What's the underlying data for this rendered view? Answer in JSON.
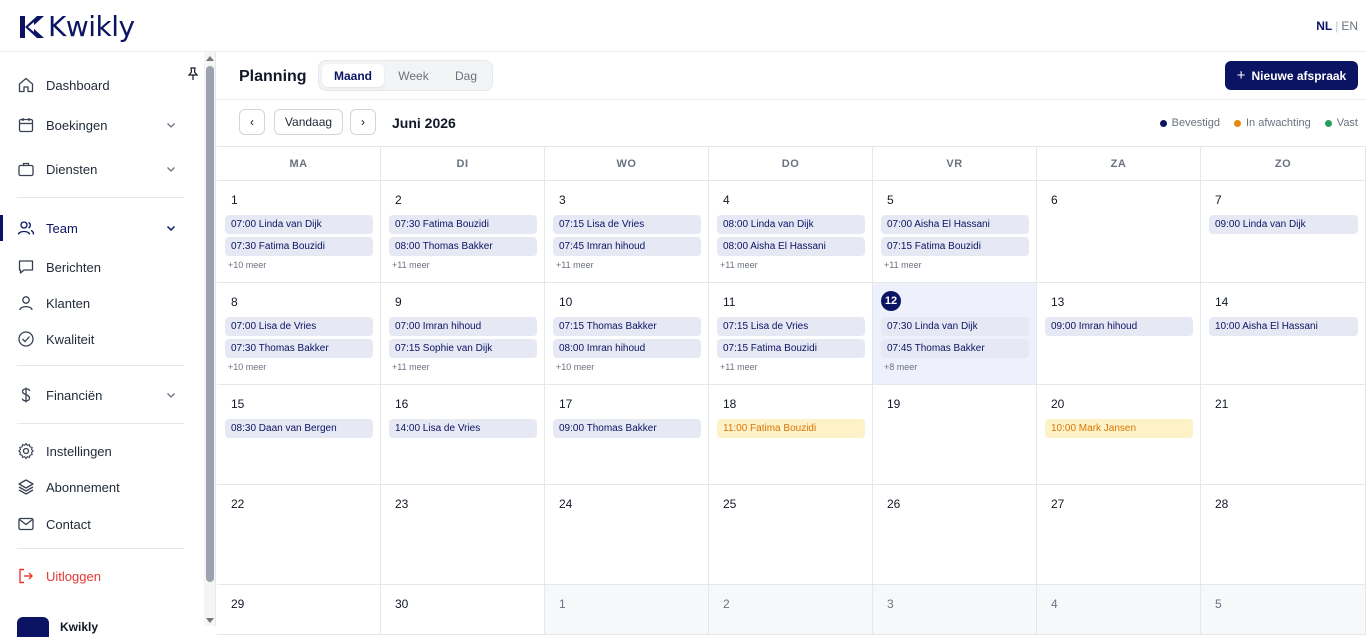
{
  "app": {
    "name": "Kwikly"
  },
  "lang": {
    "active": "NL",
    "other": "EN",
    "separator": "|"
  },
  "sidebar": {
    "items": [
      {
        "label": "Dashboard",
        "icon": "home-icon"
      },
      {
        "label": "Boekingen",
        "icon": "calendar-icon",
        "expandable": true
      },
      {
        "label": "Diensten",
        "icon": "briefcase-icon",
        "expandable": true
      },
      {
        "label": "Team",
        "icon": "users-icon",
        "expandable": true,
        "active": true
      },
      {
        "label": "Berichten",
        "icon": "message-icon"
      },
      {
        "label": "Klanten",
        "icon": "user-icon"
      },
      {
        "label": "Kwaliteit",
        "icon": "check-circle-icon"
      },
      {
        "label": "Financiën",
        "icon": "dollar-icon",
        "expandable": true
      },
      {
        "label": "Instellingen",
        "icon": "gear-icon"
      },
      {
        "label": "Abonnement",
        "icon": "layers-icon"
      },
      {
        "label": "Contact",
        "icon": "mail-icon"
      },
      {
        "label": "Uitloggen",
        "icon": "logout-icon"
      }
    ],
    "footer_name": "Kwikly"
  },
  "header": {
    "title": "Planning",
    "views": [
      "Maand",
      "Week",
      "Dag"
    ],
    "active_view": "Maand",
    "new_button": "Nieuwe afspraak"
  },
  "toolbar": {
    "prev": "‹",
    "next": "›",
    "today": "Vandaag",
    "month": "Juni 2026"
  },
  "legend": [
    {
      "label": "Bevestigd",
      "color": "#0b1463"
    },
    {
      "label": "In afwachting",
      "color": "#e58a0c"
    },
    {
      "label": "Vast",
      "color": "#22a05a"
    }
  ],
  "weekdays": [
    "MA",
    "DI",
    "WO",
    "DO",
    "VR",
    "ZA",
    "ZO"
  ],
  "weeks": [
    [
      {
        "day": "1",
        "events": [
          {
            "text": "07:00 Linda van Dijk"
          },
          {
            "text": "07:30 Fatima Bouzidi"
          }
        ],
        "more": "+10 meer"
      },
      {
        "day": "2",
        "events": [
          {
            "text": "07:30 Fatima Bouzidi"
          },
          {
            "text": "08:00 Thomas Bakker"
          }
        ],
        "more": "+11 meer"
      },
      {
        "day": "3",
        "events": [
          {
            "text": "07:15 Lisa de Vries"
          },
          {
            "text": "07:45 Imran hihoud"
          }
        ],
        "more": "+11 meer"
      },
      {
        "day": "4",
        "events": [
          {
            "text": "08:00 Linda van Dijk"
          },
          {
            "text": "08:00 Aisha El Hassani"
          }
        ],
        "more": "+11 meer"
      },
      {
        "day": "5",
        "events": [
          {
            "text": "07:00 Aisha El Hassani"
          },
          {
            "text": "07:15 Fatima Bouzidi"
          }
        ],
        "more": "+11 meer"
      },
      {
        "day": "6",
        "events": []
      },
      {
        "day": "7",
        "events": [
          {
            "text": "09:00 Linda van Dijk"
          }
        ]
      }
    ],
    [
      {
        "day": "8",
        "events": [
          {
            "text": "07:00 Lisa de Vries"
          },
          {
            "text": "07:30 Thomas Bakker"
          }
        ],
        "more": "+10 meer"
      },
      {
        "day": "9",
        "events": [
          {
            "text": "07:00 Imran hihoud"
          },
          {
            "text": "07:15 Sophie van Dijk"
          }
        ],
        "more": "+11 meer"
      },
      {
        "day": "10",
        "events": [
          {
            "text": "07:15 Thomas Bakker"
          },
          {
            "text": "08:00 Imran hihoud"
          }
        ],
        "more": "+10 meer"
      },
      {
        "day": "11",
        "events": [
          {
            "text": "07:15 Lisa de Vries"
          },
          {
            "text": "07:15 Fatima Bouzidi"
          }
        ],
        "more": "+11 meer"
      },
      {
        "day": "12",
        "today": true,
        "events": [
          {
            "text": "07:30 Linda van Dijk"
          },
          {
            "text": "07:45 Thomas Bakker"
          }
        ],
        "more": "+8 meer"
      },
      {
        "day": "13",
        "events": [
          {
            "text": "09:00 Imran hihoud"
          }
        ]
      },
      {
        "day": "14",
        "events": [
          {
            "text": "10:00 Aisha El Hassani"
          }
        ]
      }
    ],
    [
      {
        "day": "15",
        "events": [
          {
            "text": "08:30 Daan van Bergen"
          }
        ]
      },
      {
        "day": "16",
        "events": [
          {
            "text": "14:00 Lisa de Vries"
          }
        ]
      },
      {
        "day": "17",
        "events": [
          {
            "text": "09:00 Thomas Bakker"
          }
        ]
      },
      {
        "day": "18",
        "events": [
          {
            "text": "11:00 Fatima Bouzidi",
            "status": "pending"
          }
        ]
      },
      {
        "day": "19",
        "events": []
      },
      {
        "day": "20",
        "events": [
          {
            "text": "10:00 Mark Jansen",
            "status": "pending"
          }
        ]
      },
      {
        "day": "21",
        "events": []
      }
    ],
    [
      {
        "day": "22",
        "events": []
      },
      {
        "day": "23",
        "events": []
      },
      {
        "day": "24",
        "events": []
      },
      {
        "day": "25",
        "events": []
      },
      {
        "day": "26",
        "events": []
      },
      {
        "day": "27",
        "events": []
      },
      {
        "day": "28",
        "events": []
      }
    ],
    [
      {
        "day": "29",
        "events": []
      },
      {
        "day": "30",
        "events": []
      },
      {
        "day": "1",
        "outside": true,
        "events": []
      },
      {
        "day": "2",
        "outside": true,
        "events": []
      },
      {
        "day": "3",
        "outside": true,
        "events": []
      },
      {
        "day": "4",
        "outside": true,
        "events": []
      },
      {
        "day": "5",
        "outside": true,
        "events": []
      }
    ]
  ]
}
